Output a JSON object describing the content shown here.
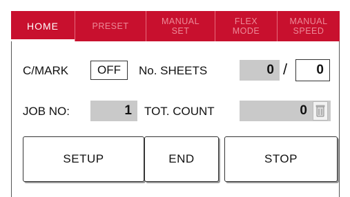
{
  "tabs": [
    {
      "label": "HOME",
      "active": true
    },
    {
      "label": "PRESET",
      "active": false
    },
    {
      "label": "MANUAL\nSET",
      "active": false
    },
    {
      "label": "FLEX\nMODE",
      "active": false
    },
    {
      "label": "MANUAL\nSPEED",
      "active": false
    }
  ],
  "cmark": {
    "label": "C/MARK",
    "value": "OFF"
  },
  "sheets": {
    "label": "No. SHEETS",
    "current": "0",
    "separator": "/",
    "target": "0"
  },
  "job": {
    "label": "JOB NO:",
    "value": "1"
  },
  "total": {
    "label": "TOT. COUNT",
    "value": "0",
    "reset_icon": "trash-icon"
  },
  "buttons": {
    "setup": "SETUP",
    "end": "END",
    "stop": "STOP"
  },
  "colors": {
    "tab_bar": "#c8102e",
    "value_field": "#c9c9c9"
  }
}
